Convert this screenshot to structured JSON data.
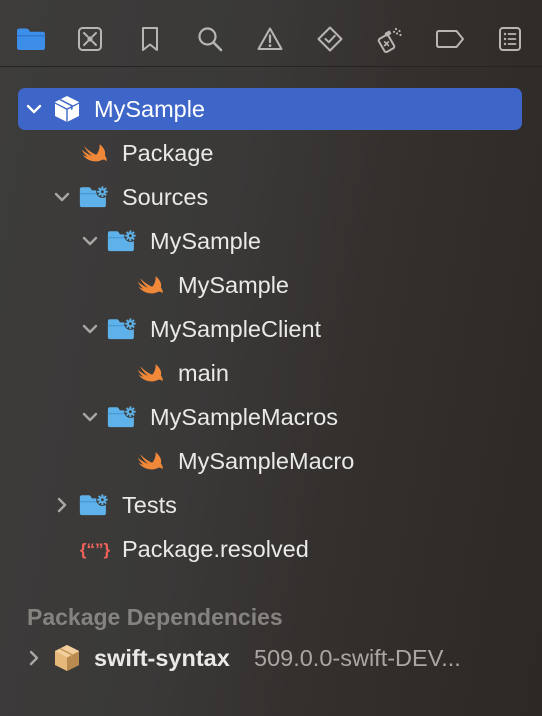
{
  "toolbar": {
    "buttons": [
      {
        "id": "project-navigator",
        "icon": "folder-icon",
        "active": true
      },
      {
        "id": "source-control-navigator",
        "icon": "source-control-icon",
        "active": false
      },
      {
        "id": "symbol-navigator",
        "icon": "bookmark-icon",
        "active": false
      },
      {
        "id": "find-navigator",
        "icon": "search-icon",
        "active": false
      },
      {
        "id": "issue-navigator",
        "icon": "warning-icon",
        "active": false
      },
      {
        "id": "test-navigator",
        "icon": "test-diamond-icon",
        "active": false
      },
      {
        "id": "debug-navigator",
        "icon": "spray-icon",
        "active": false
      },
      {
        "id": "breakpoint-navigator",
        "icon": "breakpoint-tag-icon",
        "active": false
      },
      {
        "id": "report-navigator",
        "icon": "report-list-icon",
        "active": false
      }
    ]
  },
  "tree": {
    "root": {
      "label": "MySample",
      "expanded": true,
      "selected": true,
      "icon": "package-icon"
    },
    "package_swift": {
      "label": "Package",
      "icon": "swift-icon"
    },
    "sources": {
      "label": "Sources",
      "expanded": true,
      "icon": "folder-gear-icon"
    },
    "mysample_target": {
      "label": "MySample",
      "expanded": true,
      "icon": "folder-gear-icon"
    },
    "mysample_file": {
      "label": "MySample",
      "icon": "swift-icon"
    },
    "client_target": {
      "label": "MySampleClient",
      "expanded": true,
      "icon": "folder-gear-icon"
    },
    "main_file": {
      "label": "main",
      "icon": "swift-icon"
    },
    "macros_target": {
      "label": "MySampleMacros",
      "expanded": true,
      "icon": "folder-gear-icon"
    },
    "macro_file": {
      "label": "MySampleMacro",
      "icon": "swift-icon"
    },
    "tests": {
      "label": "Tests",
      "expanded": false,
      "icon": "folder-gear-icon"
    },
    "resolved": {
      "label": "Package.resolved",
      "icon": "json-icon"
    }
  },
  "dependencies": {
    "header": "Package Dependencies",
    "items": [
      {
        "name": "swift-syntax",
        "version": "509.0.0-swift-DEV...",
        "expanded": false,
        "icon": "package-icon"
      }
    ]
  },
  "colors": {
    "selection": "#3e66c8",
    "accent_blue": "#3d8ee9",
    "swift_orange": "#f0883a",
    "folder_blue": "#5fb2e9",
    "json_red": "#f0625a",
    "package_tan": "#e6b87a"
  }
}
